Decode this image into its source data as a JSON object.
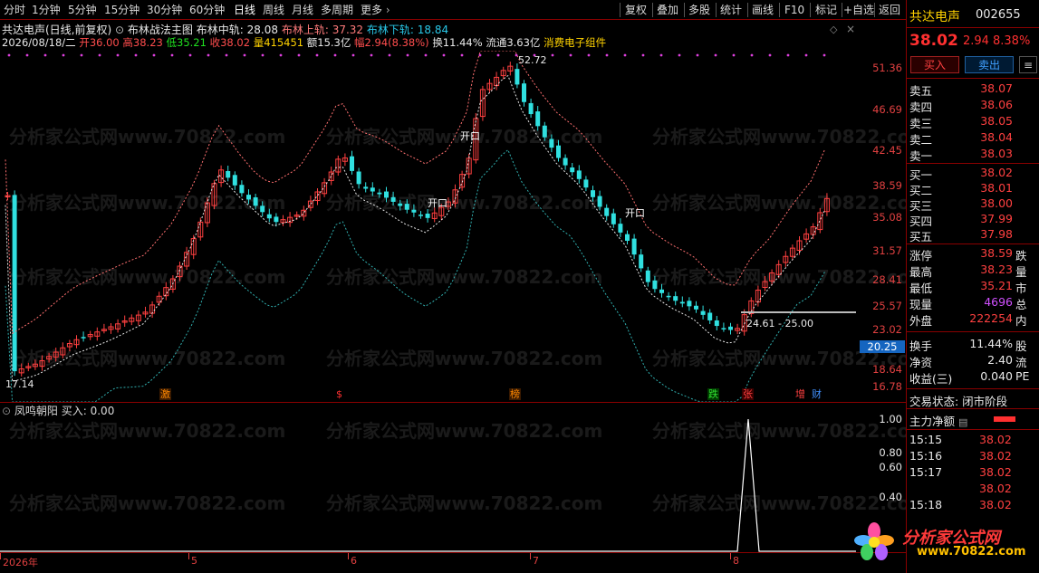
{
  "toolbar": {
    "periods": [
      "分时",
      "1分钟",
      "5分钟",
      "15分钟",
      "30分钟",
      "60分钟",
      "日线",
      "周线",
      "月线",
      "多周期",
      "更多"
    ],
    "tools": [
      "复权",
      "叠加",
      "多股",
      "统计",
      "画线",
      "F10",
      "标记",
      "+自选",
      "返回"
    ]
  },
  "header": {
    "stock_title": "共达电声(日线,前复权)",
    "indicator_name": "布林战法主图",
    "mid_label": "布林中轨:",
    "mid_value": "28.08",
    "upper_label": "布林上轨:",
    "upper_value": "37.32",
    "lower_label": "布林下轨:",
    "lower_value": "18.84",
    "date": "2026/08/18/二",
    "open_label": "开",
    "open": "36.00",
    "high_label": "高",
    "high": "38.23",
    "low_label": "低",
    "low": "35.21",
    "close_label": "收",
    "close": "38.02",
    "volume_label": "量",
    "volume": "415451",
    "amount_label": "额",
    "amount": "15.3亿",
    "range_label": "幅",
    "range": "2.94(8.38%)",
    "turnover": "换11.44%",
    "float_cap": "流通3.63亿",
    "concept": "消费电子组件"
  },
  "main_chart": {
    "annotations": {
      "peak": "52.72",
      "trough": "17.14",
      "range_box": "24.61 - 25.00",
      "open_signal_1": "开口",
      "open_signal_2": "开口",
      "open_signal_3": "开口"
    },
    "current_price_tag": "20.25",
    "price_axis": [
      "51.36",
      "46.69",
      "42.45",
      "38.59",
      "35.08",
      "31.57",
      "28.41",
      "25.57",
      "23.02",
      "18.64",
      "16.78"
    ],
    "events": [
      "激",
      "$",
      "榜",
      "跌",
      "张",
      "增",
      "财"
    ]
  },
  "sub_chart": {
    "title": "凤鸣朝阳",
    "buy_label": "买入:",
    "buy_value": "0.00",
    "axis": [
      "1.00",
      "0.80",
      "0.60",
      "0.40"
    ]
  },
  "date_axis": [
    "2026年",
    "5",
    "6",
    "7",
    "8"
  ],
  "quote_panel": {
    "name": "共达电声",
    "code": "002655",
    "price": "38.02",
    "change": "2.94",
    "change_pct": "8.38%",
    "buy_button": "买入",
    "sell_button": "卖出",
    "more_button": "≡",
    "asks": [
      {
        "label": "卖五",
        "price": "38.07"
      },
      {
        "label": "卖四",
        "price": "38.06"
      },
      {
        "label": "卖三",
        "price": "38.05"
      },
      {
        "label": "卖二",
        "price": "38.04"
      },
      {
        "label": "卖一",
        "price": "38.03"
      }
    ],
    "bids": [
      {
        "label": "买一",
        "price": "38.02"
      },
      {
        "label": "买二",
        "price": "38.01"
      },
      {
        "label": "买三",
        "price": "38.00"
      },
      {
        "label": "买四",
        "price": "37.99"
      },
      {
        "label": "买五",
        "price": "37.98"
      }
    ],
    "stats": [
      {
        "label": "涨停",
        "value": "38.59",
        "extra": "跌",
        "color": "#ff4040"
      },
      {
        "label": "最高",
        "value": "38.23",
        "extra": "量",
        "color": "#ff4040"
      },
      {
        "label": "最低",
        "value": "35.21",
        "extra": "市",
        "color": "#ff4040"
      },
      {
        "label": "现量",
        "value": "4696",
        "extra": "总",
        "color": "#d050ff"
      },
      {
        "label": "外盘",
        "value": "222254",
        "extra": "内",
        "color": "#ff4040"
      }
    ],
    "stats2": [
      {
        "label": "换手",
        "value": "11.44%",
        "extra": "股"
      },
      {
        "label": "净资",
        "value": "2.40",
        "extra": "流"
      },
      {
        "label": "收益(三)",
        "value": "0.040",
        "extra": "PE"
      }
    ],
    "trade_status": "交易状态: 闭市阶段",
    "main_flow_label": "主力净额",
    "ticks": [
      {
        "time": "15:15",
        "price": "38.02"
      },
      {
        "time": "15:16",
        "price": "38.02"
      },
      {
        "time": "15:17",
        "price": "38.02"
      },
      {
        "time": "",
        "price": "38.02"
      },
      {
        "time": "15:18",
        "price": "38.02"
      }
    ]
  },
  "logo": {
    "title": "分析家公式网",
    "url": "www.70822.com"
  },
  "watermark": "分析家公式网www.70822.com",
  "colors": {
    "up": "#ff4040",
    "down": "#30e0e0",
    "background": "#000000",
    "frame": "#8a0000"
  }
}
